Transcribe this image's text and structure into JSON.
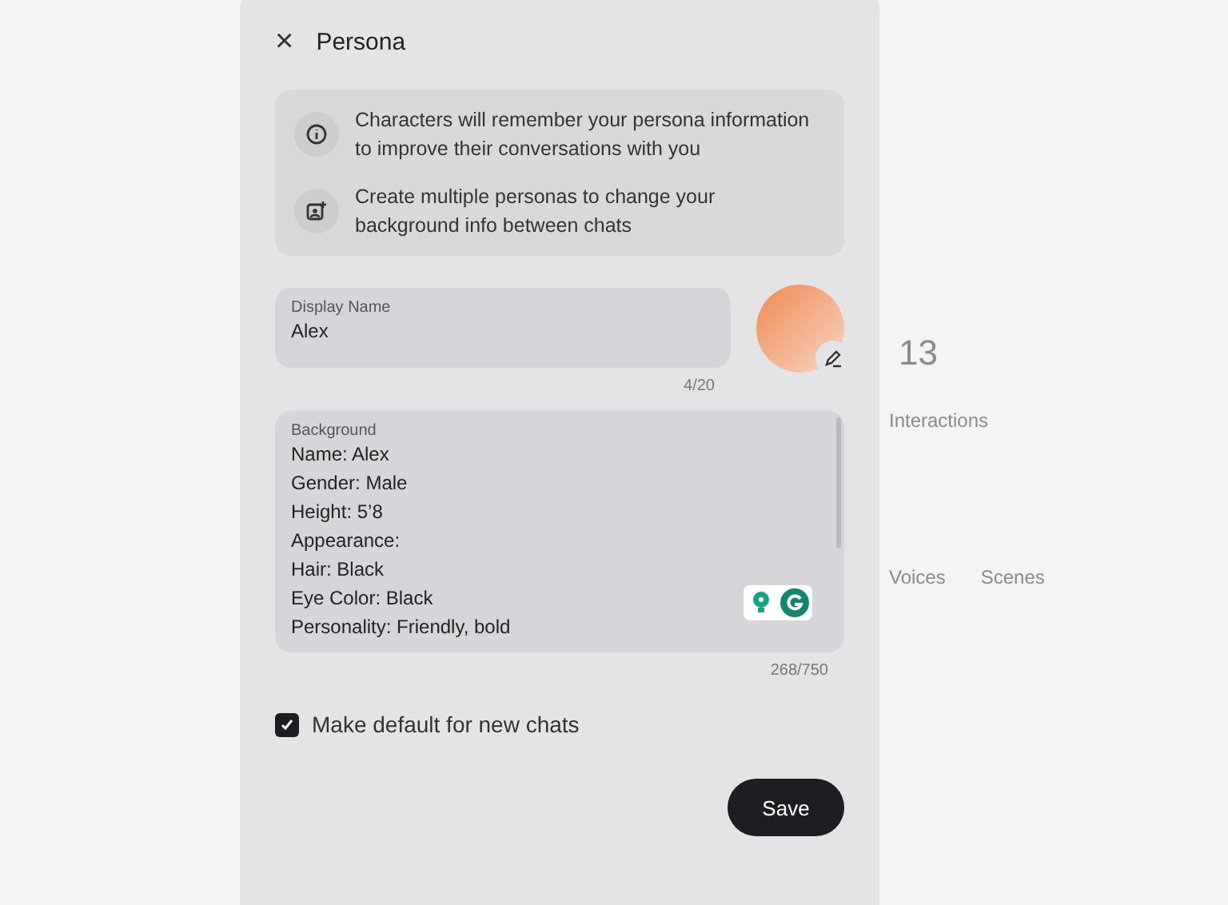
{
  "background_page": {
    "stat": "13",
    "stat_label": "Interactions",
    "tabs": [
      {
        "label": "Voices",
        "selected": false
      },
      {
        "label": "Scenes",
        "selected": false
      }
    ]
  },
  "dialog": {
    "title": "Persona",
    "close": "×",
    "info": [
      {
        "kind": "info",
        "text": "Characters will remember your persona information to improve their conversations with you"
      },
      {
        "kind": "personas",
        "text": "Create multiple personas to change your background info between chats"
      }
    ],
    "display_name": {
      "label": "Display Name",
      "value": "Alex",
      "counter": "4/20"
    },
    "background": {
      "label": "Background",
      "lines": [
        "Name: Alex",
        "Gender: Male",
        "Height: 5’8",
        "Appearance:",
        "Hair: Black",
        "Eye Color: Black",
        "Personality: Friendly, bold"
      ],
      "counter": "268/750"
    },
    "default_checkbox": {
      "label": "Make default for new chats",
      "checked": true
    },
    "save": "Save"
  }
}
